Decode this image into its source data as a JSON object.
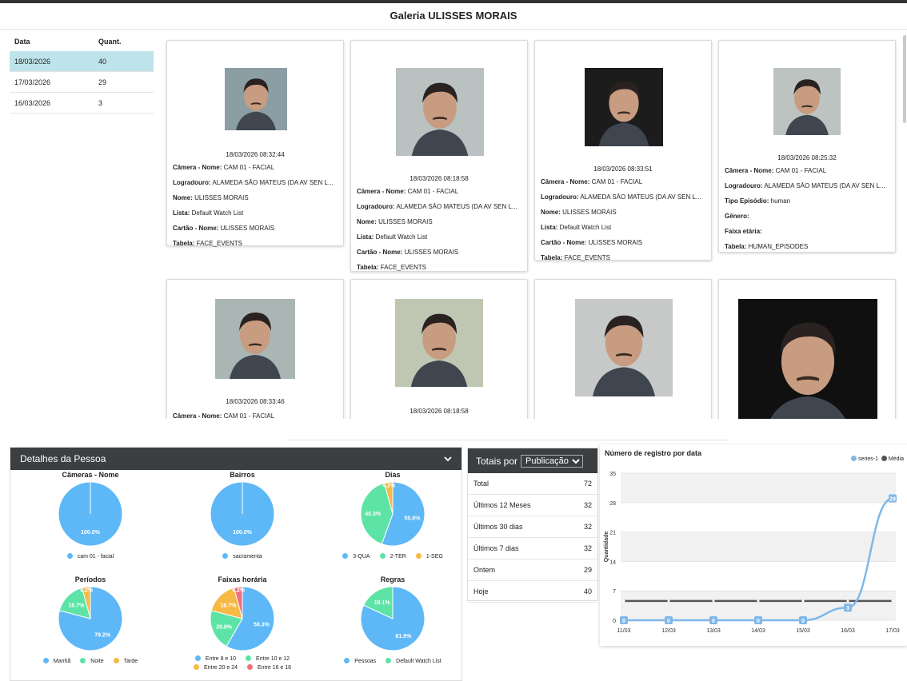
{
  "gallery": {
    "title": "Galeria ULISSES MORAIS"
  },
  "date_table": {
    "headers": [
      "Data",
      "Quant."
    ],
    "rows": [
      {
        "date": "18/03/2026",
        "count": "40"
      },
      {
        "date": "17/03/2026",
        "count": "29"
      },
      {
        "date": "16/03/2026",
        "count": "3"
      }
    ]
  },
  "cards": [
    {
      "timestamp": "18/03/2026 08:32:44",
      "fields": [
        [
          "Câmera - Nome:",
          "CAM 01 - FACIAL"
        ],
        [
          "Logradouro:",
          "ALAMEDA SÃO MATEUS (DA AV SEN L..."
        ],
        [
          "Nome:",
          "ULISSES MORAIS"
        ],
        [
          "Lista:",
          "Default Watch List"
        ],
        [
          "Cartão - Nome:",
          "ULISSES MORAIS"
        ],
        [
          "Tabela:",
          "FACE_EVENTS"
        ]
      ]
    },
    {
      "timestamp": "18/03/2026 08:18:58",
      "fields": [
        [
          "Câmera - Nome:",
          "CAM 01 - FACIAL"
        ],
        [
          "Logradouro:",
          "ALAMEDA SÃO MATEUS (DA AV SEN L..."
        ],
        [
          "Nome:",
          "ULISSES MORAIS"
        ],
        [
          "Lista:",
          "Default Watch List"
        ],
        [
          "Cartão - Nome:",
          "ULISSES MORAIS"
        ],
        [
          "Tabela:",
          "FACE_EVENTS"
        ]
      ]
    },
    {
      "timestamp": "18/03/2026 08:33:51",
      "fields": [
        [
          "Câmera - Nome:",
          "CAM 01 - FACIAL"
        ],
        [
          "Logradouro:",
          "ALAMEDA SÃO MATEUS (DA AV SEN L..."
        ],
        [
          "Nome:",
          "ULISSES MORAIS"
        ],
        [
          "Lista:",
          "Default Watch List"
        ],
        [
          "Cartão - Nome:",
          "ULISSES MORAIS"
        ],
        [
          "Tabela:",
          "FACE_EVENTS"
        ]
      ]
    },
    {
      "timestamp": "18/03/2026 08:25:32",
      "fields": [
        [
          "Câmera - Nome:",
          "CAM 01 - FACIAL"
        ],
        [
          "Logradouro:",
          "ALAMEDA SÃO MATEUS (DA AV SEN L..."
        ],
        [
          "Tipo Episódio:",
          "human"
        ],
        [
          "Gênero:",
          ""
        ],
        [
          "Faixa etária:",
          ""
        ],
        [
          "Tabela:",
          "HUMAN_EPISODES"
        ]
      ]
    },
    {
      "timestamp": "18/03/2026 08:33:46",
      "fields": [
        [
          "Câmera - Nome:",
          "CAM 01 - FACIAL"
        ]
      ]
    },
    {
      "timestamp": "18/03/2026 08:18:58",
      "fields": []
    },
    {
      "timestamp": "",
      "fields": []
    },
    {
      "timestamp": "",
      "fields": []
    }
  ],
  "details": {
    "title": "Detalhes da Pessoa"
  },
  "pies": [
    {
      "title": "Câmeras - Nome",
      "slices": [
        {
          "label": "cam 01 - facial",
          "value": 100.0,
          "text": "100.0%",
          "color": "#5eb8f7"
        }
      ]
    },
    {
      "title": "Bairros",
      "slices": [
        {
          "label": "sacramenta",
          "value": 100.0,
          "text": "100.0%",
          "color": "#5eb8f7"
        }
      ]
    },
    {
      "title": "Dias",
      "slices": [
        {
          "label": "3-QUA",
          "value": 55.6,
          "text": "55.6%",
          "color": "#5eb8f7"
        },
        {
          "label": "2-TER",
          "value": 40.3,
          "text": "40.3%",
          "color": "#5ee3a6"
        },
        {
          "label": "1-SEG",
          "value": 4.2,
          "text": "4.2%",
          "color": "#f7b946"
        }
      ]
    },
    {
      "title": "Períodos",
      "slices": [
        {
          "label": "Manhã",
          "value": 79.2,
          "text": "79.2%",
          "color": "#5eb8f7"
        },
        {
          "label": "Noite",
          "value": 16.7,
          "text": "16.7%",
          "color": "#5ee3a6"
        },
        {
          "label": "Tarde",
          "value": 4.2,
          "text": "4.2%",
          "color": "#f7b946"
        }
      ]
    },
    {
      "title": "Faixas horária",
      "slices": [
        {
          "label": "Entre 8 e 10",
          "value": 58.3,
          "text": "58.3%",
          "color": "#5eb8f7"
        },
        {
          "label": "Entre 10 e 12",
          "value": 20.8,
          "text": "20.8%",
          "color": "#5ee3a6"
        },
        {
          "label": "Entre 20 e 24",
          "value": 16.7,
          "text": "16.7%",
          "color": "#f7b946"
        },
        {
          "label": "Entre 16 e 18",
          "value": 4.2,
          "text": "4.2%",
          "color": "#f26d7d"
        }
      ]
    },
    {
      "title": "Regras",
      "slices": [
        {
          "label": "Pessoas",
          "value": 81.9,
          "text": "81.9%",
          "color": "#5eb8f7"
        },
        {
          "label": "Default Watch List",
          "value": 18.1,
          "text": "18.1%",
          "color": "#5ee3a6"
        }
      ]
    }
  ],
  "totals": {
    "label": "Totais por",
    "select": "Publicação",
    "rows": [
      {
        "label": "Total",
        "value": "72"
      },
      {
        "label": "Últimos 12 Meses",
        "value": "32"
      },
      {
        "label": "Últimos 30 dias",
        "value": "32"
      },
      {
        "label": "Últimos 7 dias",
        "value": "32"
      },
      {
        "label": "Ontem",
        "value": "29"
      },
      {
        "label": "Hoje",
        "value": "40"
      }
    ]
  },
  "chart_data": {
    "type": "line",
    "title": "Número de registro por data",
    "ylabel": "Quantidade",
    "categories": [
      "11/03",
      "12/03",
      "13/03",
      "14/03",
      "15/03",
      "16/03",
      "17/03"
    ],
    "series": [
      {
        "name": "series-1",
        "values": [
          0,
          0,
          0,
          0,
          0,
          3,
          29
        ],
        "color": "#7fb8e8"
      },
      {
        "name": "Média",
        "values": [
          4.6,
          4.6,
          4.6,
          4.6,
          4.6,
          4.6,
          4.6
        ],
        "color": "#555555"
      }
    ],
    "yticks": [
      0,
      7,
      14,
      21,
      28,
      35
    ],
    "ylim": [
      0,
      35
    ],
    "legend": "top-right"
  }
}
